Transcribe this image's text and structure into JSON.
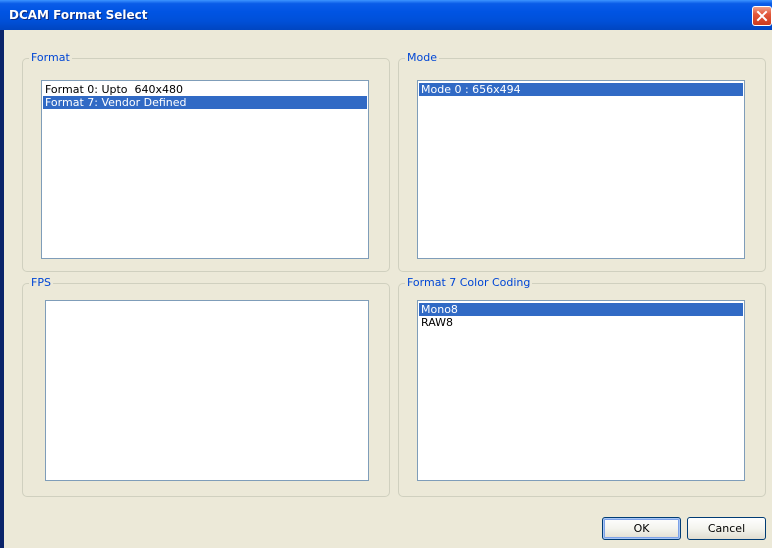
{
  "window": {
    "title": "DCAM Format Select"
  },
  "groups": {
    "format": {
      "label": "Format",
      "items": [
        {
          "text": "Format 0: Upto  640x480",
          "selected": false
        },
        {
          "text": "Format 7: Vendor Defined",
          "selected": true
        }
      ]
    },
    "mode": {
      "label": "Mode",
      "items": [
        {
          "text": "Mode 0 : 656x494",
          "selected": true
        }
      ]
    },
    "fps": {
      "label": "FPS",
      "items": []
    },
    "color_coding": {
      "label": "Format 7 Color Coding",
      "items": [
        {
          "text": "Mono8",
          "selected": true
        },
        {
          "text": "RAW8",
          "selected": false
        }
      ]
    }
  },
  "buttons": {
    "ok_label": "OK",
    "cancel_label": "Cancel"
  },
  "icons": {
    "close": "close-icon"
  },
  "colors": {
    "selection": "#316ac5",
    "group_label": "#0046d5",
    "dialog_bg": "#ece9d8",
    "titlebar": "#0054e3"
  }
}
